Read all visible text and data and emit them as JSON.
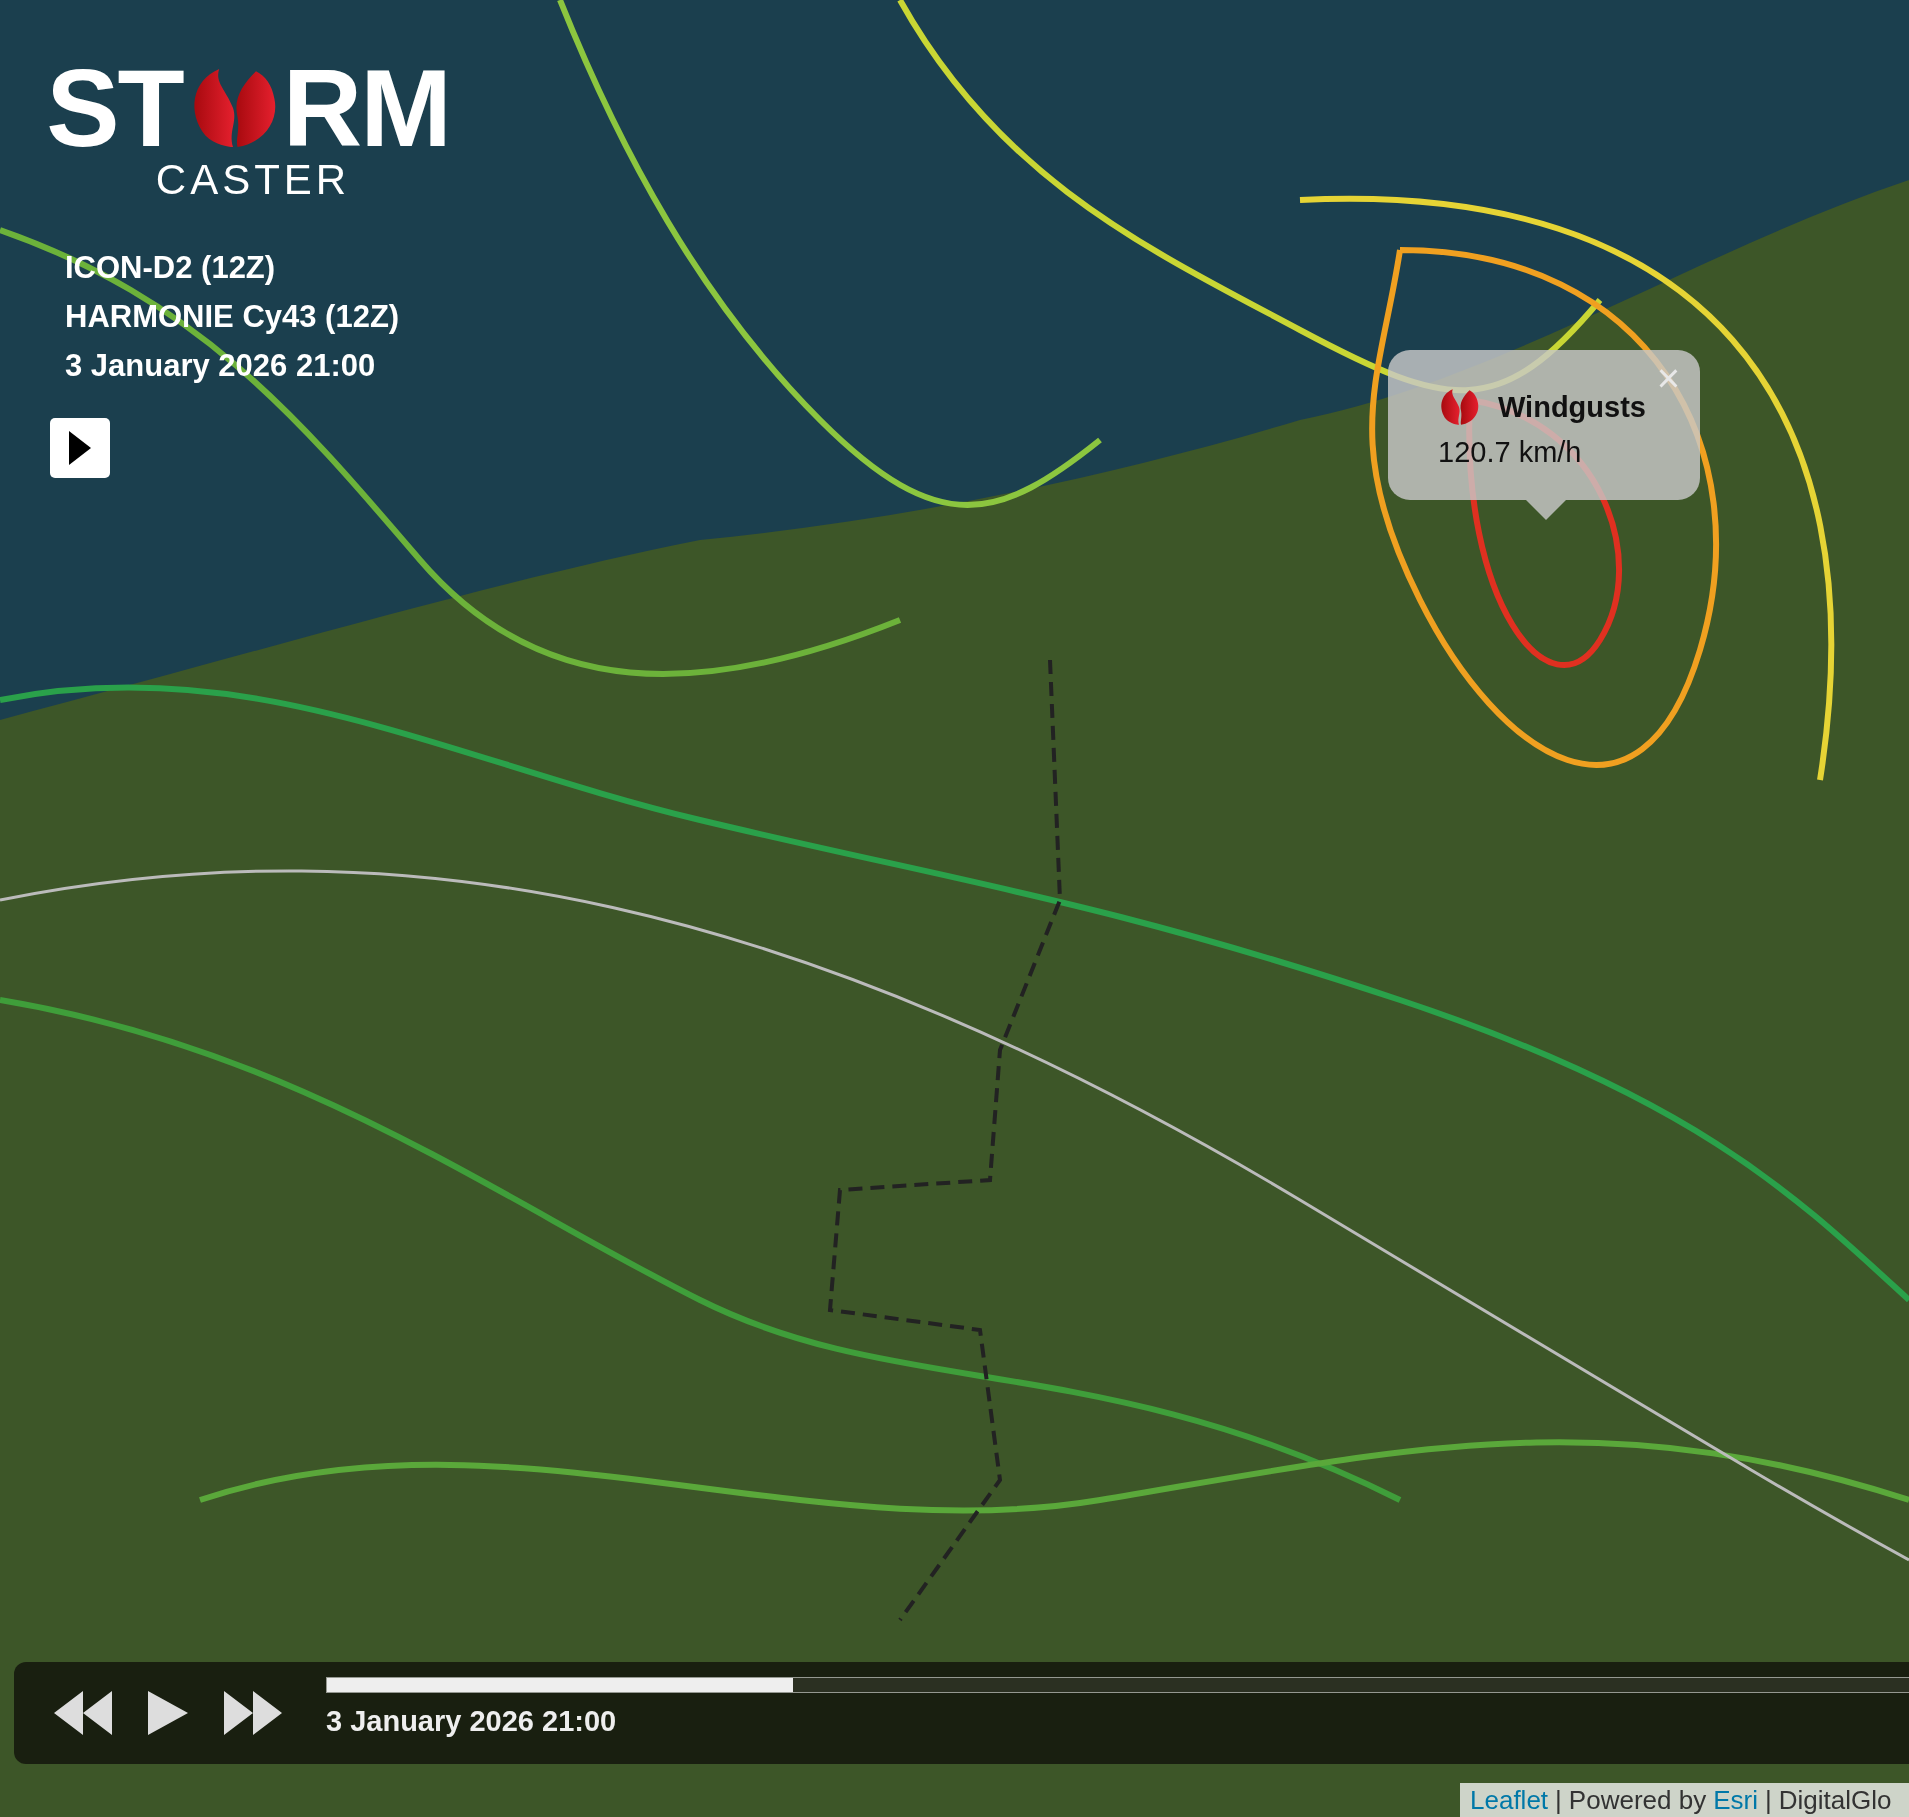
{
  "logo": {
    "top_left": "ST",
    "top_right": "RM",
    "bottom": "CASTER"
  },
  "info": {
    "lines": [
      "ICON-D2 (12Z)",
      "HARMONIE Cy43 (12Z)",
      "3 January 2026 21:00"
    ]
  },
  "popup": {
    "title": "Windgusts",
    "value": "120.7 km/h",
    "close": "×"
  },
  "timebar": {
    "time": "3 January 2026 21:00",
    "level": 0.29
  },
  "attribution": [
    {
      "kind": "link",
      "text": "Leaflet"
    },
    {
      "kind": "separator",
      "text": "|"
    },
    {
      "kind": "text",
      "text": "Powered by"
    },
    {
      "kind": "link",
      "text": "Esri"
    },
    {
      "kind": "separator",
      "text": "|"
    },
    {
      "kind": "text",
      "text": "DigitalGlo"
    }
  ]
}
